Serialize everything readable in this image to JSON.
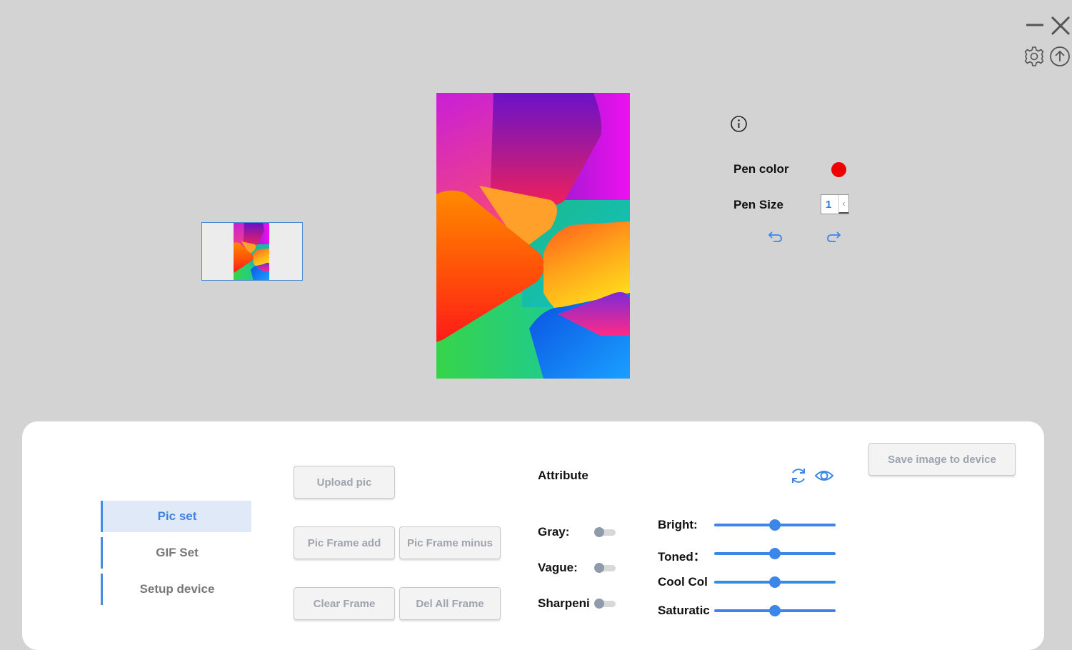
{
  "window": {
    "controls": [
      "minimize-icon",
      "close-icon",
      "gear-icon",
      "upload-icon"
    ]
  },
  "editor": {
    "pen_color_label": "Pen color",
    "pen_color": "#ee0000",
    "pen_size_label": "Pen Size",
    "pen_size_value": "1",
    "icons": [
      "info-icon",
      "undo-icon",
      "redo-icon"
    ]
  },
  "nav": {
    "items": [
      {
        "label": "Pic set",
        "active": true
      },
      {
        "label": "GIF Set",
        "active": false
      },
      {
        "label": "Setup device",
        "active": false
      }
    ]
  },
  "actions": {
    "upload": "Upload pic",
    "frame_add": "Pic Frame add",
    "frame_minus": "Pic Frame minus",
    "clear_frame": "Clear Frame",
    "del_all_frame": "Del All Frame",
    "save_to_device": "Save image to device"
  },
  "attribute": {
    "title": "Attribute",
    "toggles": [
      {
        "label": "Gray:",
        "on": false
      },
      {
        "label": "Vague:",
        "on": false
      },
      {
        "label": "Sharpeni",
        "on": false
      }
    ],
    "sliders": [
      {
        "label": "Bright:",
        "value": 0.5
      },
      {
        "label": "Toned：",
        "value": 0.5
      },
      {
        "label": "Cool Col",
        "value": 0.5
      },
      {
        "label": "Saturatic",
        "value": 0.5
      }
    ]
  },
  "colors": {
    "accent": "#3c86e8",
    "nav_active_bg": "#dfe9f8",
    "background": "#d3d3d3"
  }
}
